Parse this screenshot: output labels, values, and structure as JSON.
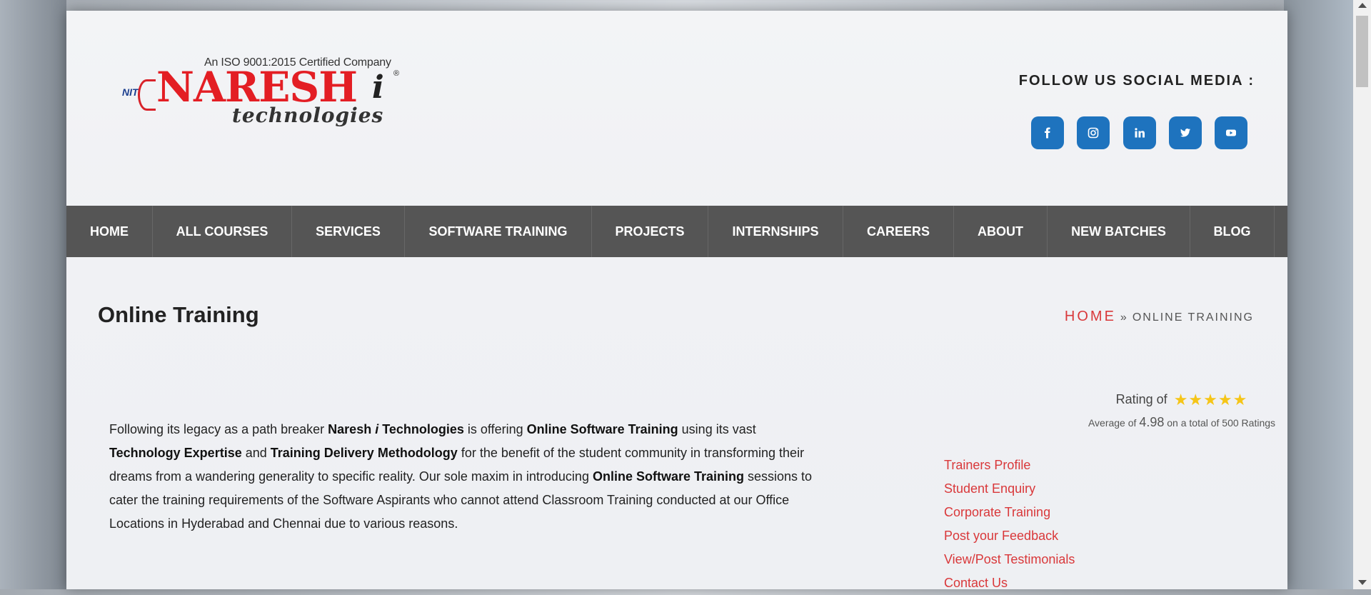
{
  "header": {
    "logo": {
      "cert": "An ISO 9001:2015 Certified Company",
      "nit": "NIT",
      "name": "NARESH",
      "i": "i",
      "reg": "®",
      "tagline": "technologies"
    },
    "follow_label": "FOLLOW US SOCIAL MEDIA :",
    "socials": [
      {
        "name": "facebook-icon"
      },
      {
        "name": "instagram-icon"
      },
      {
        "name": "linkedin-icon"
      },
      {
        "name": "twitter-icon"
      },
      {
        "name": "youtube-icon"
      }
    ],
    "social_color": "#1e73be"
  },
  "nav": {
    "items": [
      "HOME",
      "ALL COURSES",
      "SERVICES",
      "SOFTWARE TRAINING",
      "PROJECTS",
      "INTERNSHIPS",
      "CAREERS",
      "ABOUT",
      "NEW BATCHES",
      "BLOG"
    ],
    "bg_color": "#555555"
  },
  "page": {
    "title": "Online Training",
    "breadcrumb": {
      "home": "HOME",
      "separator": "»",
      "current": "ONLINE TRAINING"
    }
  },
  "content": {
    "p1": "Following its legacy as a path breaker ",
    "b1": "Naresh ",
    "b1i": "i",
    "b1b": " Technologies",
    "p2": " is offering ",
    "b2": "Online Software Training",
    "p3": " using its vast ",
    "b3": "Technology Expertise",
    "p4": " and ",
    "b4": "Training Delivery Methodology",
    "p5": " for the benefit of the student community in transforming their dreams from a wandering generality to specific reality. Our sole maxim in introducing ",
    "b5": "Online Software Training",
    "p6": " sessions to cater the training requirements of the Software Aspirants who cannot attend Classroom Training conducted at our Office Locations in Hyderabad and Chennai due to various reasons."
  },
  "rating": {
    "label": "Rating of",
    "stars": 5,
    "avg_prefix": "Average of",
    "avg_value": "4.98",
    "avg_suffix": "on a total of 500 Ratings",
    "star_color": "#f5c518"
  },
  "sidebar_links": [
    "Trainers Profile",
    "Student Enquiry",
    "Corporate Training",
    "Post your Feedback",
    "View/Post Testimonials",
    "Contact Us"
  ],
  "link_color": "#d9383a"
}
